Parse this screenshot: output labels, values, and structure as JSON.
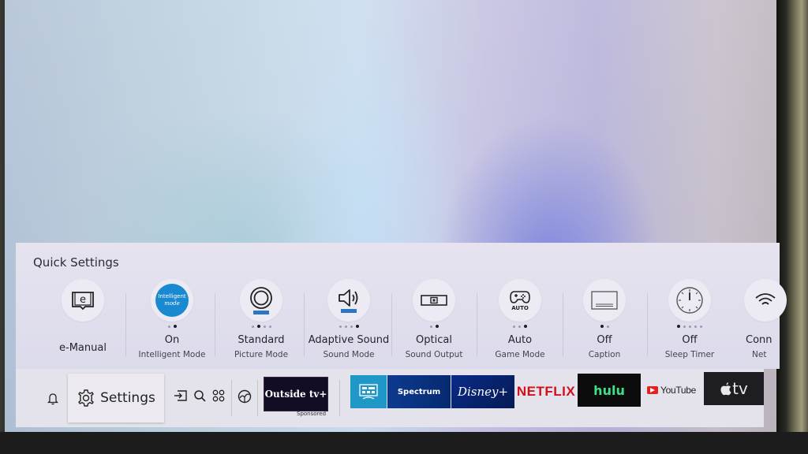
{
  "quick_settings": {
    "title": "Quick Settings",
    "items": [
      {
        "icon": "book-e-icon",
        "value": "e-Manual",
        "label": "",
        "dots": 0,
        "active_dot": -1
      },
      {
        "icon": "intelligent-mode-icon",
        "badge_line1": "Intelligent",
        "badge_line2": "mode",
        "value": "On",
        "label": "Intelligent Mode",
        "dots": 2,
        "active_dot": 1
      },
      {
        "icon": "picture-mode-icon",
        "value": "Standard",
        "label": "Picture Mode",
        "dots": 4,
        "active_dot": 1
      },
      {
        "icon": "speaker-icon",
        "value": "Adaptive Sound",
        "label": "Sound Mode",
        "dots": 4,
        "active_dot": 3
      },
      {
        "icon": "optical-output-icon",
        "value": "Optical",
        "label": "Sound Output",
        "dots": 2,
        "active_dot": 1
      },
      {
        "icon": "gamepad-icon",
        "badge": "AUTO",
        "value": "Auto",
        "label": "Game Mode",
        "dots": 3,
        "active_dot": 2
      },
      {
        "icon": "caption-icon",
        "value": "Off",
        "label": "Caption",
        "dots": 2,
        "active_dot": 0
      },
      {
        "icon": "clock-icon",
        "value": "Off",
        "label": "Sleep Timer",
        "dots": 5,
        "active_dot": 0
      },
      {
        "icon": "wifi-icon",
        "value": "Conn",
        "label": "Net",
        "dots": 0,
        "active_dot": -1
      }
    ]
  },
  "taskbar": {
    "settings_label": "Settings",
    "icons": [
      "bell-icon",
      "source-input-icon",
      "search-icon",
      "apps-icon",
      "ambient-icon"
    ],
    "sponsored_tile": {
      "label": "Outside tv+",
      "caption": "Sponsored"
    },
    "apps": [
      {
        "name": "Smart Hub"
      },
      {
        "name": "Spectrum",
        "label": "Spectrum"
      },
      {
        "name": "Disney+",
        "label": "Disney+"
      },
      {
        "name": "Netflix",
        "label": "NETFLIX"
      },
      {
        "name": "Hulu",
        "label": "hulu"
      },
      {
        "name": "YouTube",
        "label": "YouTube"
      },
      {
        "name": "Apple TV",
        "label": "tv"
      }
    ]
  },
  "colors": {
    "netflix_red": "#d0101c",
    "hulu_green": "#3ee088",
    "youtube_red": "#e52020",
    "intelligent_blue": "#1a8ad0"
  }
}
